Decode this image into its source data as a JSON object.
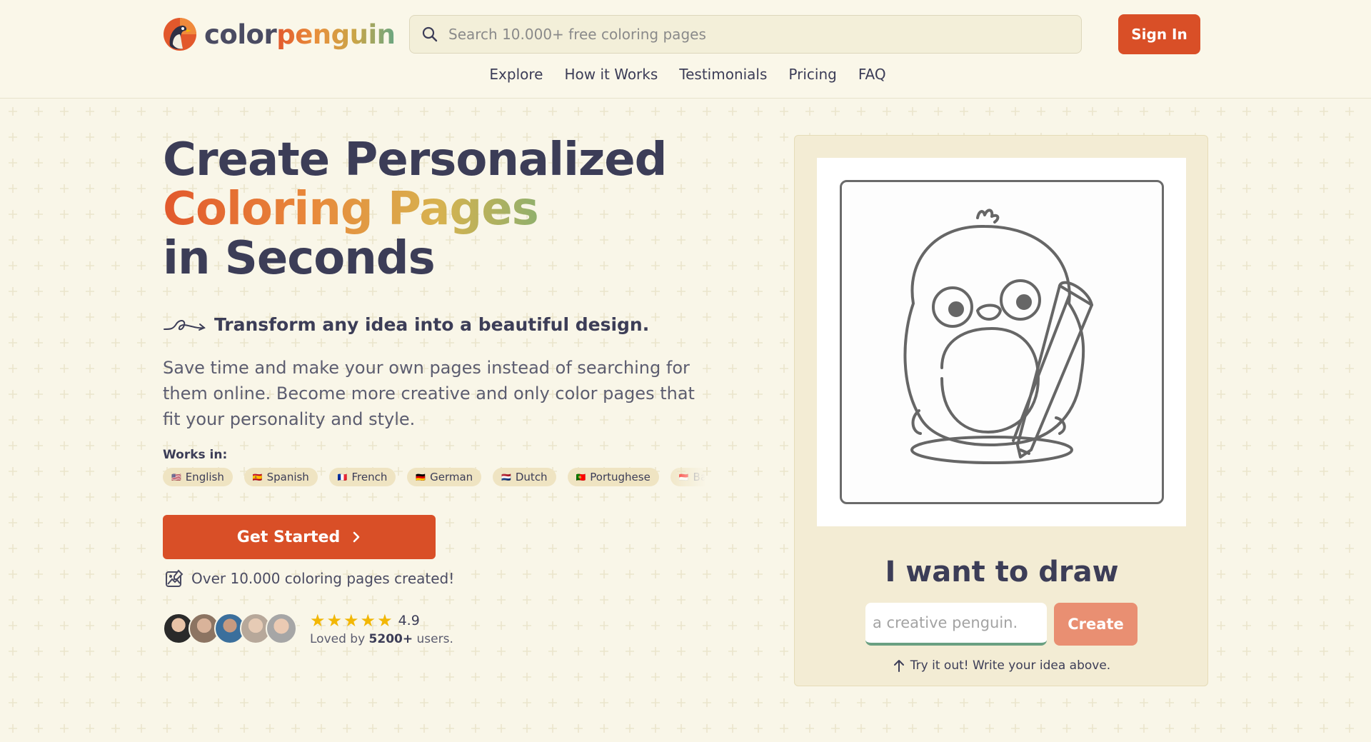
{
  "brand": {
    "name_part1": "color",
    "name_part2": "penguin"
  },
  "search": {
    "placeholder": "Search 10.000+ free coloring pages"
  },
  "header": {
    "signin_label": "Sign In"
  },
  "nav": {
    "items": [
      {
        "label": "Explore"
      },
      {
        "label": "How it Works"
      },
      {
        "label": "Testimonials"
      },
      {
        "label": "Pricing"
      },
      {
        "label": "FAQ"
      }
    ]
  },
  "hero": {
    "title_line1": "Create Personalized",
    "title_line2": "Coloring Pages",
    "title_line3": "in Seconds",
    "tagline": "Transform any idea into a beautiful design.",
    "description": "Save time and make your own pages instead of searching for them online. Become more creative and only color pages that fit your personality and style.",
    "works_in_label": "Works in:",
    "languages": [
      {
        "flag": "🇺🇸",
        "label": "English"
      },
      {
        "flag": "🇪🇸",
        "label": "Spanish"
      },
      {
        "flag": "🇫🇷",
        "label": "French"
      },
      {
        "flag": "🇩🇪",
        "label": "German"
      },
      {
        "flag": "🇳🇱",
        "label": "Dutch"
      },
      {
        "flag": "🇵🇹",
        "label": "Portughese"
      },
      {
        "flag": "🇮🇩",
        "label": "Bahasa"
      }
    ],
    "cta_label": "Get Started",
    "created_text": "Over 10.000 coloring pages created!",
    "rating": {
      "score": "4.9",
      "stars": 5,
      "loved_prefix": "Loved by",
      "loved_count": "5200+",
      "loved_suffix": "users."
    }
  },
  "demo": {
    "title": "I want to draw",
    "input_placeholder": "a creative penguin.",
    "create_label": "Create",
    "hint": "Try it out! Write your idea above."
  },
  "colors": {
    "accent": "#d94f27",
    "text": "#3c3d57",
    "background": "#f9f6e8"
  }
}
